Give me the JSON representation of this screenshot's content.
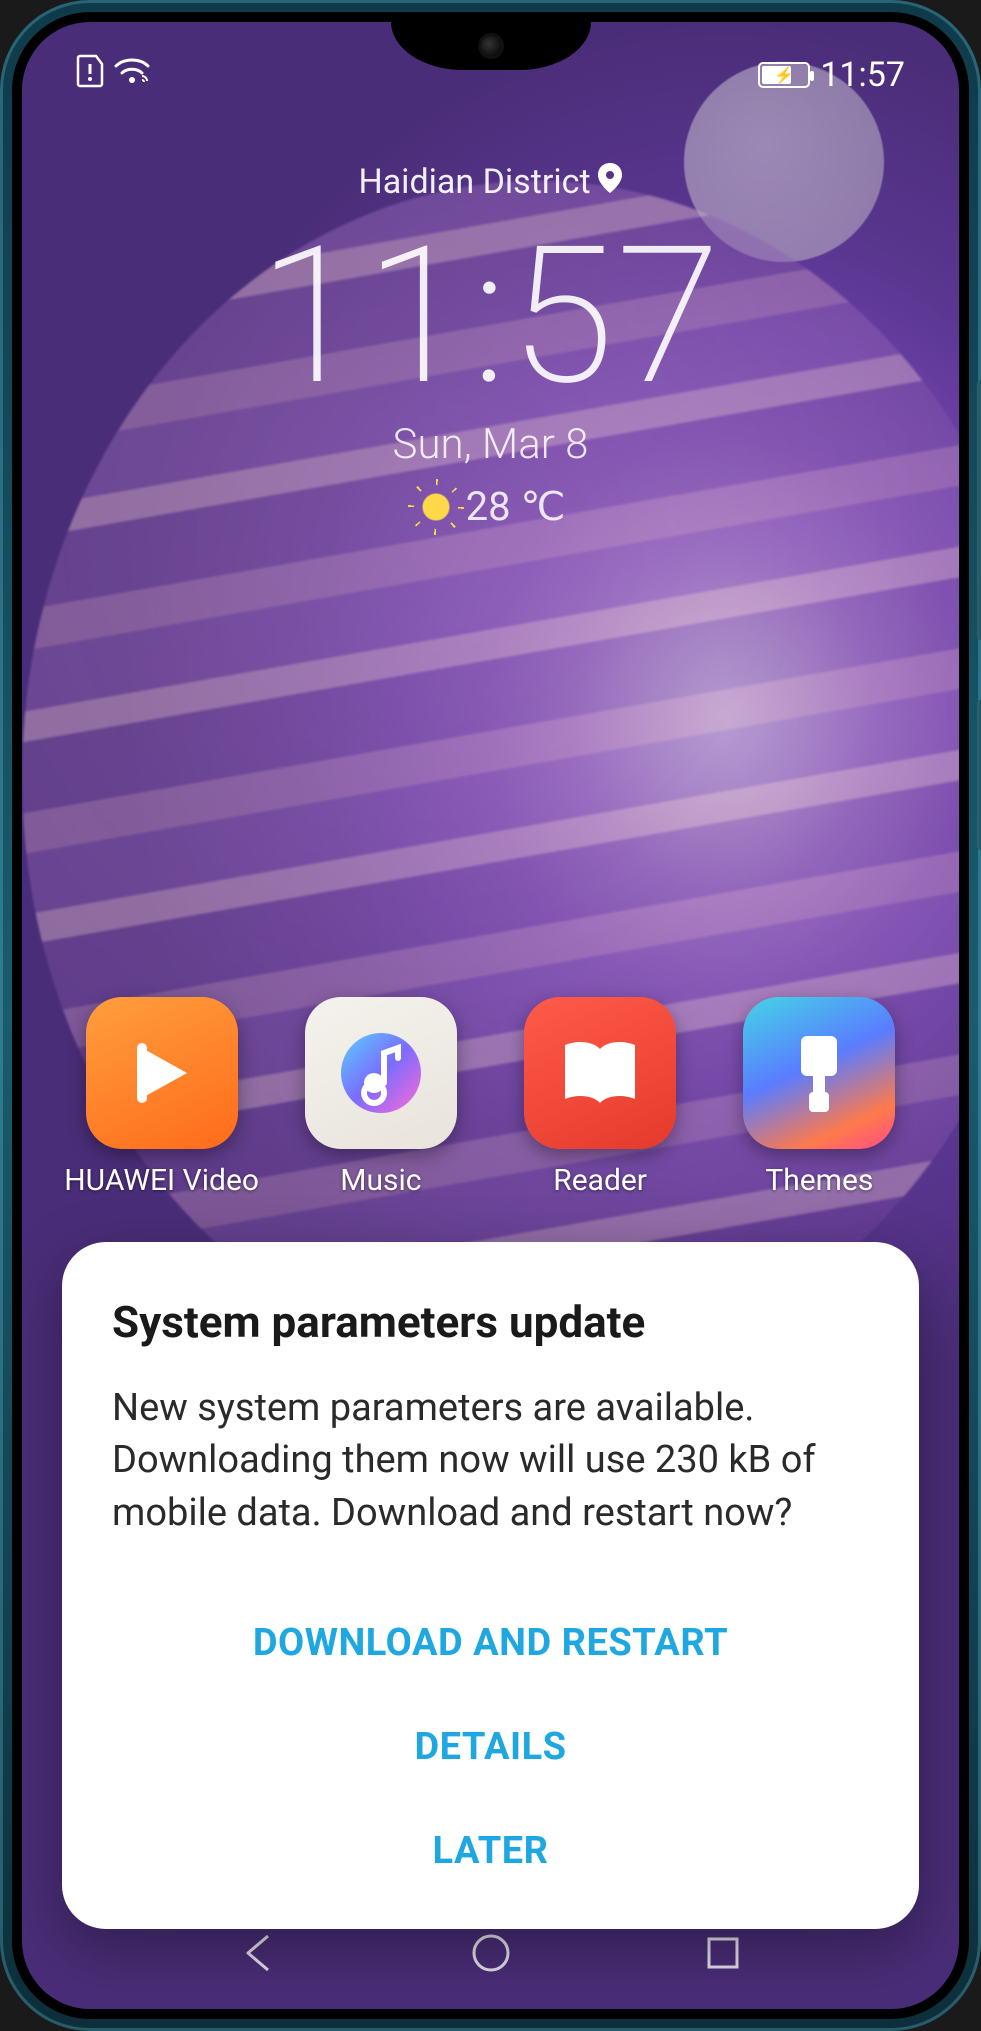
{
  "statusbar": {
    "time": "11:57"
  },
  "lockscreen": {
    "location": "Haidian District",
    "time": "11:57",
    "date": "Sun, Mar 8",
    "temperature": "28 ℃"
  },
  "apps": [
    {
      "label": "HUAWEI Video",
      "icon": "video"
    },
    {
      "label": "Music",
      "icon": "music"
    },
    {
      "label": "Reader",
      "icon": "reader"
    },
    {
      "label": "Themes",
      "icon": "themes"
    }
  ],
  "dialog": {
    "title": "System parameters update",
    "body": "New system parameters are available. Downloading them now will use 230 kB of mobile data. Download and restart now?",
    "buttons": {
      "primary": "DOWNLOAD AND RESTART",
      "details": "DETAILS",
      "later": "LATER"
    }
  }
}
